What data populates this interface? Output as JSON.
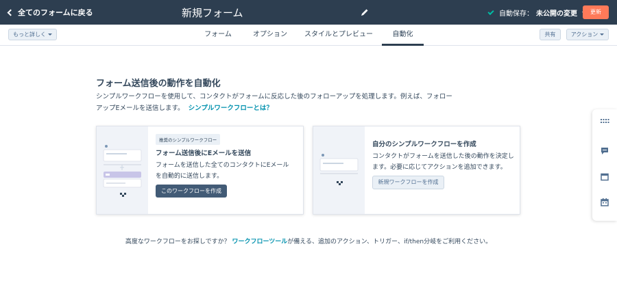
{
  "topbar": {
    "back_label": "全てのフォームに戻る",
    "form_title": "新規フォーム",
    "autosave_label": "自動保存：",
    "autosave_value": "未公開の変更",
    "update_label": "更新"
  },
  "tabrow": {
    "more_label": "もっと詳しく",
    "tabs": [
      "フォーム",
      "オプション",
      "スタイルとプレビュー",
      "自動化"
    ],
    "active_tab": "自動化",
    "share_label": "共有",
    "actions_label": "アクション"
  },
  "main": {
    "heading": "フォーム送信後の動作を自動化",
    "intro": "シンプルワークフローを使用して、コンタクトがフォームに反応した後のフォローアップを処理します。例えば、フォローアップEメールを送信します。",
    "intro_link": "シンプルワークフローとは？"
  },
  "cards": [
    {
      "badge": "推奨のシンプルワークフロー",
      "title": "フォーム送信後にEメールを送信",
      "text": "フォームを送信した全てのコンタクトにEメールを自動的に送信します。",
      "button": "このワークフローを作成"
    },
    {
      "title": "自分のシンプルワークフローを作成",
      "text": "コンタクトがフォームを送信した後の動作を決定します。必要に応じてアクションを追加できます。",
      "button": "新規ワークフローを作成"
    }
  ],
  "footer": {
    "prefix": "高度なワークフローをお探しですか？",
    "link": "ワークフローツール",
    "suffix": "が備える、追加のアクション、トリガー、if/then分岐をご利用ください。"
  },
  "sidepanel": {
    "icons": [
      "grid-icon",
      "chat-icon",
      "window-icon",
      "calendar-icon"
    ]
  },
  "colors": {
    "topbar": "#2d3e50",
    "accent": "#ff7a59",
    "link": "#0091ae",
    "check": "#00bda5"
  }
}
